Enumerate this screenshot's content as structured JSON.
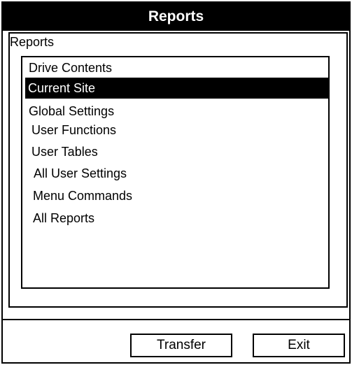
{
  "window": {
    "title": "Reports"
  },
  "panel": {
    "label": "Reports"
  },
  "list": {
    "items": [
      {
        "label": "Drive Contents",
        "selected": false
      },
      {
        "label": "Current Site",
        "selected": true
      },
      {
        "label": "Global Settings",
        "selected": false
      },
      {
        "label": "User Functions",
        "selected": false
      },
      {
        "label": "User Tables",
        "selected": false
      },
      {
        "label": "All User Settings",
        "selected": false
      },
      {
        "label": "Menu Commands",
        "selected": false
      },
      {
        "label": "All Reports",
        "selected": false
      }
    ]
  },
  "buttons": {
    "transfer_label": "Transfer",
    "exit_label": "Exit"
  }
}
